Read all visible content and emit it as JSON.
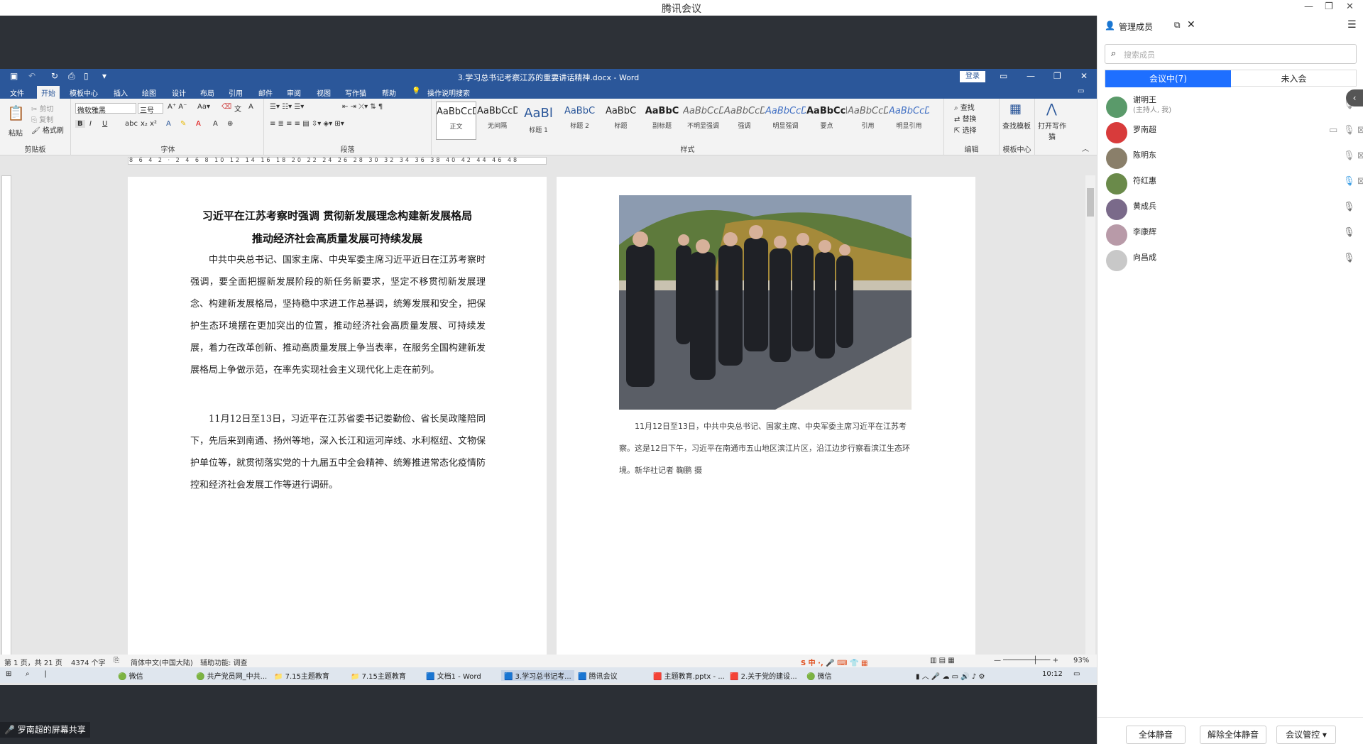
{
  "meeting_title": "腾讯会议",
  "word": {
    "doc_title": "3.学习总书记考察江苏的重要讲话精神.docx - Word",
    "login": "登录",
    "tabs": [
      "文件",
      "开始",
      "模板中心",
      "插入",
      "绘图",
      "设计",
      "布局",
      "引用",
      "邮件",
      "审阅",
      "视图",
      "写作猫",
      "帮助",
      "操作说明搜索"
    ],
    "clipboard": {
      "paste": "粘贴",
      "cut": "剪切",
      "copy": "复制",
      "format": "格式刷",
      "label": "剪贴板"
    },
    "font": {
      "name": "微软雅黑",
      "size": "三号",
      "label": "字体"
    },
    "paragraph_label": "段落",
    "styles": [
      {
        "sample": "AaBbCcDı",
        "name": "正文"
      },
      {
        "sample": "AaBbCcDı",
        "name": "无间隔"
      },
      {
        "sample": "AaBl",
        "name": "标题 1"
      },
      {
        "sample": "AaBbC",
        "name": "标题 2"
      },
      {
        "sample": "AaBbC",
        "name": "标题"
      },
      {
        "sample": "AaBbC",
        "name": "副标题"
      },
      {
        "sample": "AaBbCcD",
        "name": "不明显强调"
      },
      {
        "sample": "AaBbCcD",
        "name": "强调"
      },
      {
        "sample": "AaBbCcD",
        "name": "明显强调"
      },
      {
        "sample": "AaBbCcD",
        "name": "要点"
      },
      {
        "sample": "AaBbCcD",
        "name": "引用"
      },
      {
        "sample": "AaBbCcD",
        "name": "明显引用"
      }
    ],
    "styles_label": "样式",
    "editing": {
      "find": "查找",
      "replace": "替换",
      "select": "选择",
      "label": "编辑"
    },
    "template": {
      "find": "查找模板",
      "label": "模板中心"
    },
    "writecat": "打开写作猫",
    "doc": {
      "heading1": "习近平在江苏考察时强调 贯彻新发展理念构建新发展格局",
      "heading2": "推动经济社会高质量发展可持续发展",
      "para1": "中共中央总书记、国家主席、中央军委主席习近平近日在江苏考察时强调，要全面把握新发展阶段的新任务新要求，坚定不移贯彻新发展理念、构建新发展格局，坚持稳中求进工作总基调，统筹发展和安全，把保护生态环境摆在更加突出的位置，推动经济社会高质量发展、可持续发展，着力在改革创新、推动高质量发展上争当表率，在服务全国构建新发展格局上争做示范，在率先实现社会主义现代化上走在前列。",
      "para2": "11月12日至13日，习近平在江苏省委书记娄勤俭、省长吴政隆陪同下，先后来到南通、扬州等地，深入长江和运河岸线、水利枢纽、文物保护单位等，就贯彻落实党的十九届五中全会精神、统筹推进常态化疫情防控和经济社会发展工作等进行调研。",
      "caption": "11月12日至13日，中共中央总书记、国家主席、中央军委主席习近平在江苏考察。这是12日下午，习近平在南通市五山地区滨江片区，沿江边步行察看滨江生态环境。新华社记者 鞠鹏 摄"
    },
    "status": {
      "page": "第 1 页，共 21 页",
      "words": "4374 个字",
      "lang": "简体中文(中国大陆)",
      "access": "辅助功能: 调查",
      "zoom": "93%"
    }
  },
  "taskbar": {
    "items": [
      "微信",
      "共产党员网_中共...",
      "7.15主题教育",
      "7.15主题教育",
      "文档1 - Word",
      "3.学习总书记考...",
      "腾讯会议",
      "主题教育.pptx - ...",
      "2.关于党的建设...",
      "微信"
    ],
    "time": "10:12"
  },
  "share_label": "罗南超的屏幕共享",
  "panel": {
    "title": "管理成员",
    "search_placeholder": "搜索成员",
    "tab_in": "会议中(7)",
    "tab_out": "未入会",
    "members": [
      {
        "name": "谢明王",
        "sub": "(主持人, 我)",
        "color": "#5a9a6a",
        "mic": "muted"
      },
      {
        "name": "罗南超",
        "sub": "",
        "color": "#d83b3b",
        "mic": "on"
      },
      {
        "name": "陈明东",
        "sub": "",
        "color": "#8a7f6a",
        "mic": "on"
      },
      {
        "name": "符红惠",
        "sub": "",
        "color": "#6a8a4a",
        "mic": "speaking"
      },
      {
        "name": "黄成兵",
        "sub": "",
        "color": "#7a6a8a",
        "mic": "off"
      },
      {
        "name": "李康辉",
        "sub": "",
        "color": "#b89aa8",
        "mic": "off"
      },
      {
        "name": "向昌成",
        "sub": "",
        "color": "#c8c8c8",
        "mic": "off"
      }
    ],
    "buttons": {
      "mute_all": "全体静音",
      "unmute_all": "解除全体静音",
      "manage": "会议管控"
    }
  },
  "colors": {
    "word_blue": "#2b579a",
    "meeting_blue": "#1e6fff"
  }
}
